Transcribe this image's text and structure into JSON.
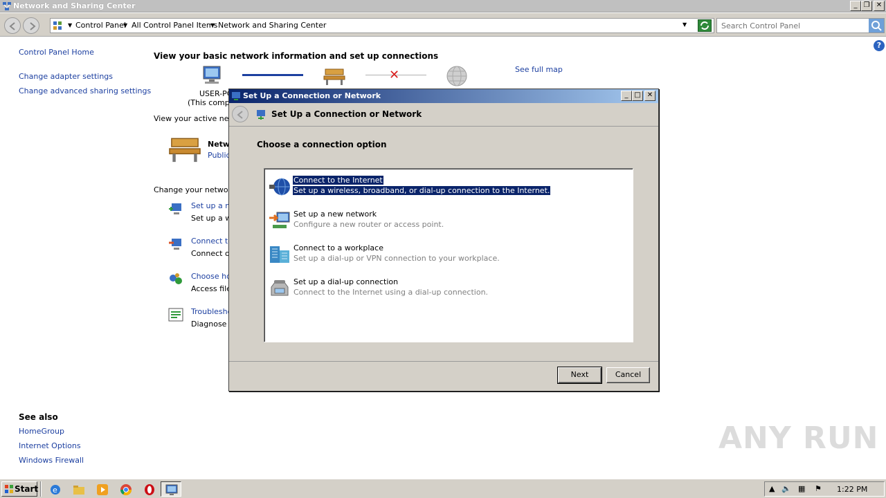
{
  "window": {
    "title": "Network and Sharing Center",
    "caption_buttons": [
      "_",
      "❐",
      "✕"
    ]
  },
  "address_bar": {
    "crumbs": [
      "Control Panel",
      "All Control Panel Items",
      "Network and Sharing Center"
    ],
    "search_placeholder": "Search Control Panel"
  },
  "left_pane": {
    "home": "Control Panel Home",
    "links": [
      "Change adapter settings",
      "Change advanced sharing settings"
    ]
  },
  "see_also": {
    "header": "See also",
    "links": [
      "HomeGroup",
      "Internet Options",
      "Windows Firewall"
    ]
  },
  "main": {
    "heading": "View your basic network information and set up connections",
    "computer_name": "USER-PC",
    "computer_sub": "(This compu",
    "see_full_map": "See full map",
    "active_networks": "View your active netw",
    "network_name": "Netw",
    "network_type": "Public",
    "change_settings": "Change your networki",
    "tasks": [
      {
        "link": "Set up a ne",
        "desc": "Set up a wi"
      },
      {
        "link": "Connect to",
        "desc": "Connect or"
      },
      {
        "link": "Choose hor",
        "desc": "Access files"
      },
      {
        "link": "Troublesho",
        "desc": "Diagnose a"
      }
    ]
  },
  "dialog": {
    "title": "Set Up a Connection or Network",
    "header_title": "Set Up a Connection or Network",
    "instruction": "Choose a connection option",
    "options": [
      {
        "title": "Connect to the Internet",
        "desc": "Set up a wireless, broadband, or dial-up connection to the Internet.",
        "selected": true
      },
      {
        "title": "Set up a new network",
        "desc": "Configure a new router or access point.",
        "selected": false
      },
      {
        "title": "Connect to a workplace",
        "desc": "Set up a dial-up or VPN connection to your workplace.",
        "selected": false
      },
      {
        "title": "Set up a dial-up connection",
        "desc": "Connect to the Internet using a dial-up connection.",
        "selected": false
      }
    ],
    "next_label": "Next",
    "cancel_label": "Cancel"
  },
  "watermark": "ANY RUN",
  "taskbar": {
    "start_label": "Start",
    "clock": "1:22 PM",
    "apps": [
      "internet-explorer-icon",
      "file-explorer-icon",
      "media-player-icon",
      "chrome-icon",
      "opera-icon",
      "control-panel-icon"
    ]
  }
}
